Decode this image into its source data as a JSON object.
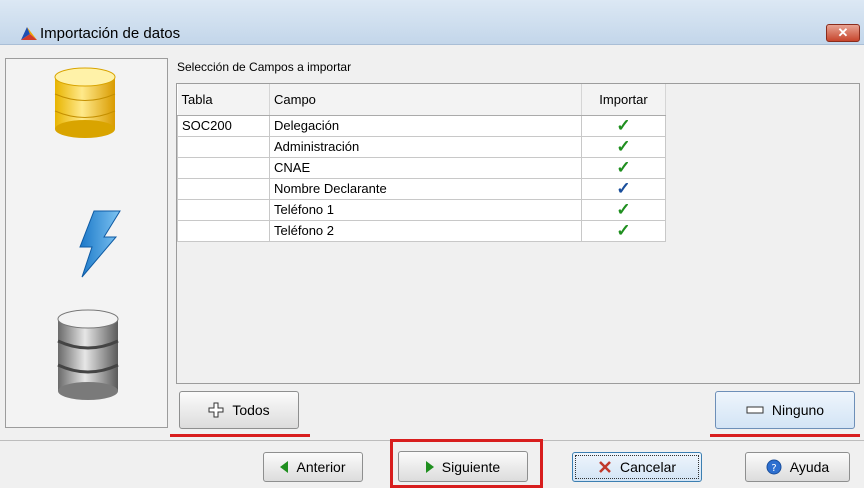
{
  "window": {
    "title": "Importación de datos",
    "close_symbol": "✕"
  },
  "section": {
    "label": "Selección de Campos a importar"
  },
  "table": {
    "headers": [
      "Tabla",
      "Campo",
      "Importar"
    ],
    "rows": [
      {
        "tabla": "SOC200",
        "campo": "Delegación",
        "importar": true
      },
      {
        "tabla": "",
        "campo": "Administración",
        "importar": true
      },
      {
        "tabla": "",
        "campo": "CNAE",
        "importar": true
      },
      {
        "tabla": "",
        "campo": "Nombre Declarante",
        "importar": true
      },
      {
        "tabla": "",
        "campo": "Teléfono 1",
        "importar": true
      },
      {
        "tabla": "",
        "campo": "Teléfono 2",
        "importar": true
      }
    ]
  },
  "buttons": {
    "todos": "Todos",
    "ninguno": "Ninguno",
    "anterior": "Anterior",
    "siguiente": "Siguiente",
    "cancelar": "Cancelar",
    "ayuda": "Ayuda"
  },
  "icons": {
    "check": "✓",
    "check_green": "#1f8f1f",
    "check_blue": "#1a4f9c",
    "highlight_red": "#d81e1e"
  }
}
